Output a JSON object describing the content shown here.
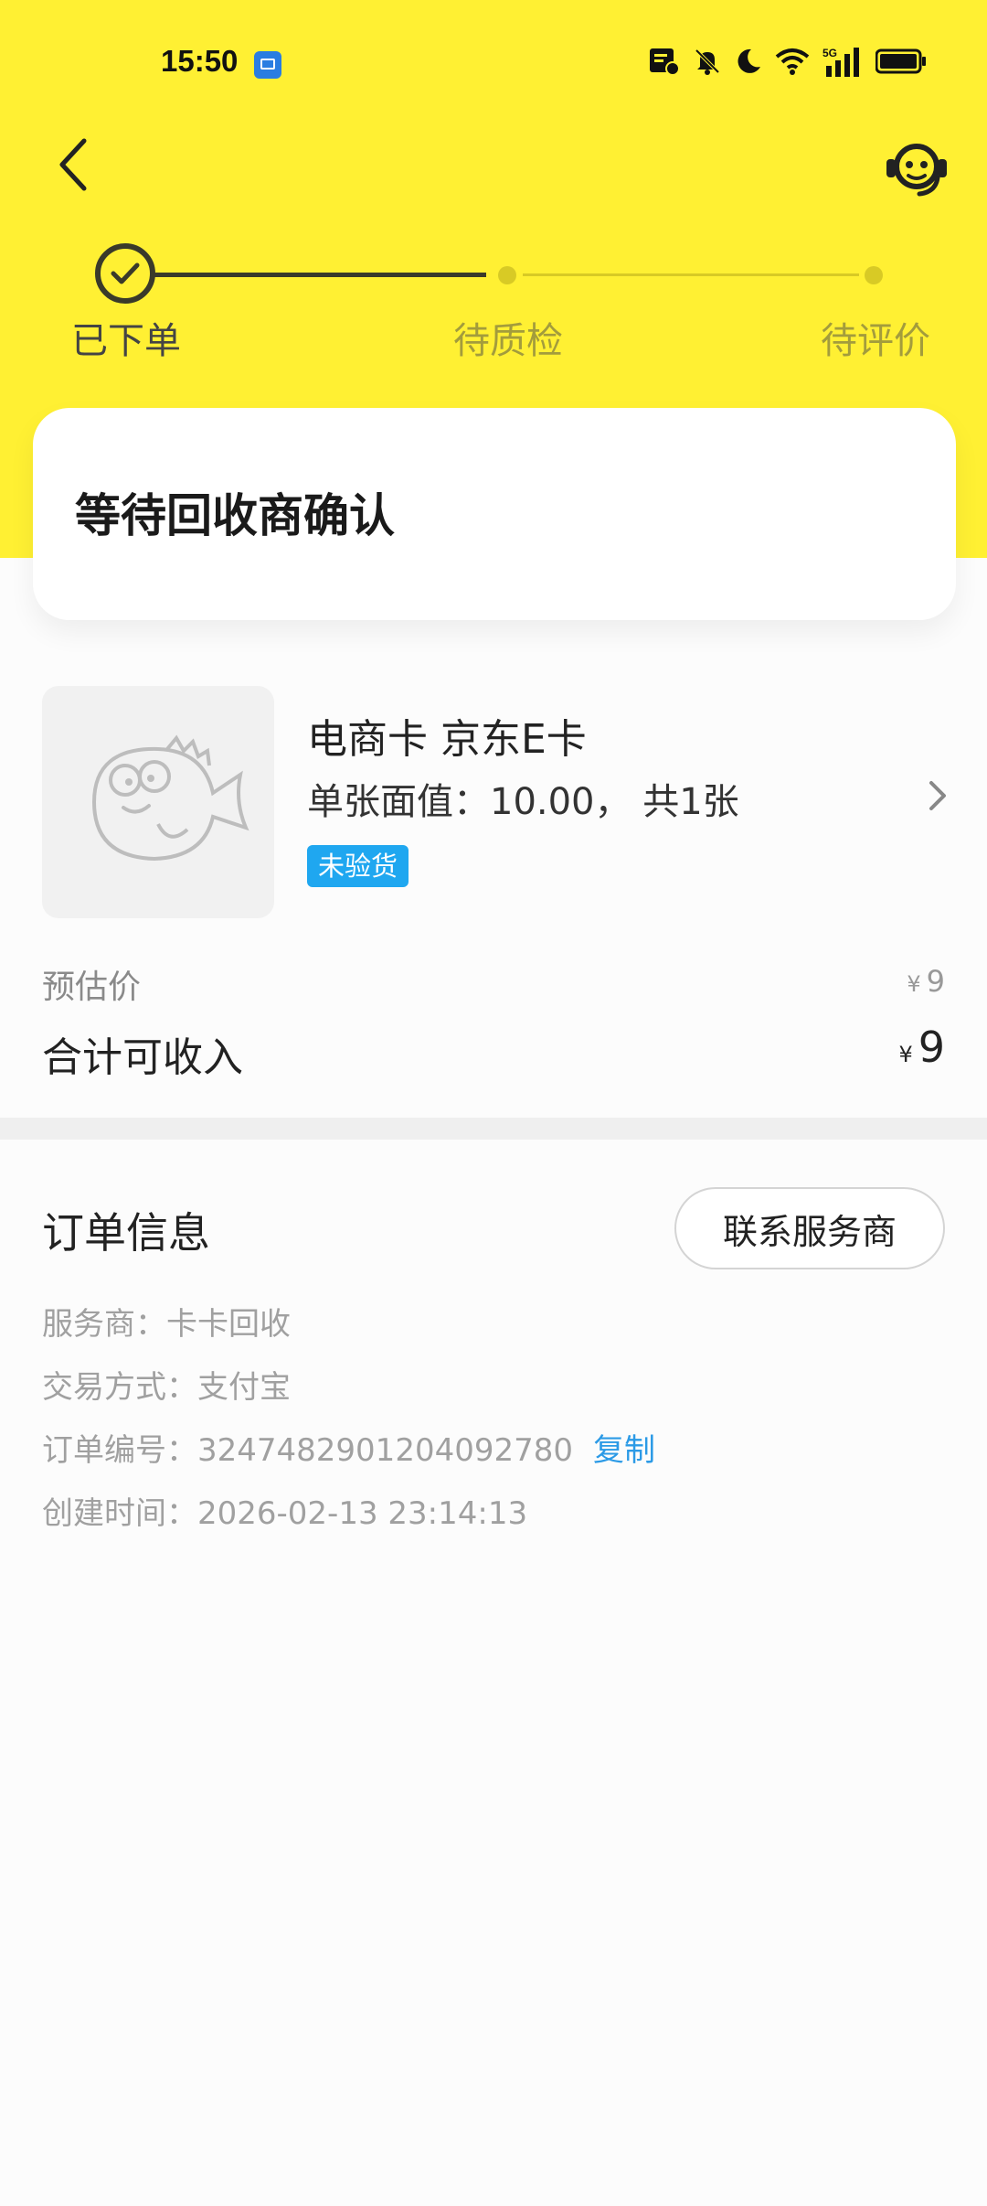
{
  "status_bar": {
    "time": "15:50",
    "icons": [
      "app-notification-icon",
      "sim-card-icon",
      "bell-off-icon",
      "moon-icon",
      "wifi-icon",
      "5g-signal-icon",
      "battery-icon"
    ],
    "network": "5G"
  },
  "nav": {
    "back_icon": "chevron-left-icon",
    "support_icon": "customer-service-icon"
  },
  "steps": [
    {
      "label": "已下单",
      "state": "done"
    },
    {
      "label": "待质检",
      "state": "todo"
    },
    {
      "label": "待评价",
      "state": "todo"
    }
  ],
  "status": {
    "title": "等待回收商确认"
  },
  "product": {
    "name": "电商卡 京东E卡",
    "spec": "单张面值：10.00， 共1张",
    "badge": "未验货"
  },
  "pricing": {
    "estimate_label": "预估价",
    "estimate_currency": "¥",
    "estimate_value": "9",
    "total_label": "合计可收入",
    "total_currency": "¥",
    "total_value": "9"
  },
  "order_info": {
    "title": "订单信息",
    "contact_button": "联系服务商",
    "provider": "服务商：卡卡回收",
    "payment": "交易方式：支付宝",
    "order_no": "订单编号：3247482901204092780",
    "copy_label": "复制",
    "created": "创建时间：2026-02-13 23:14:13"
  },
  "colors": {
    "header_yellow": "#fff033",
    "step_accent": "#d8ca25",
    "badge_blue": "#1fa7f0",
    "link_blue": "#2b9ae6"
  }
}
